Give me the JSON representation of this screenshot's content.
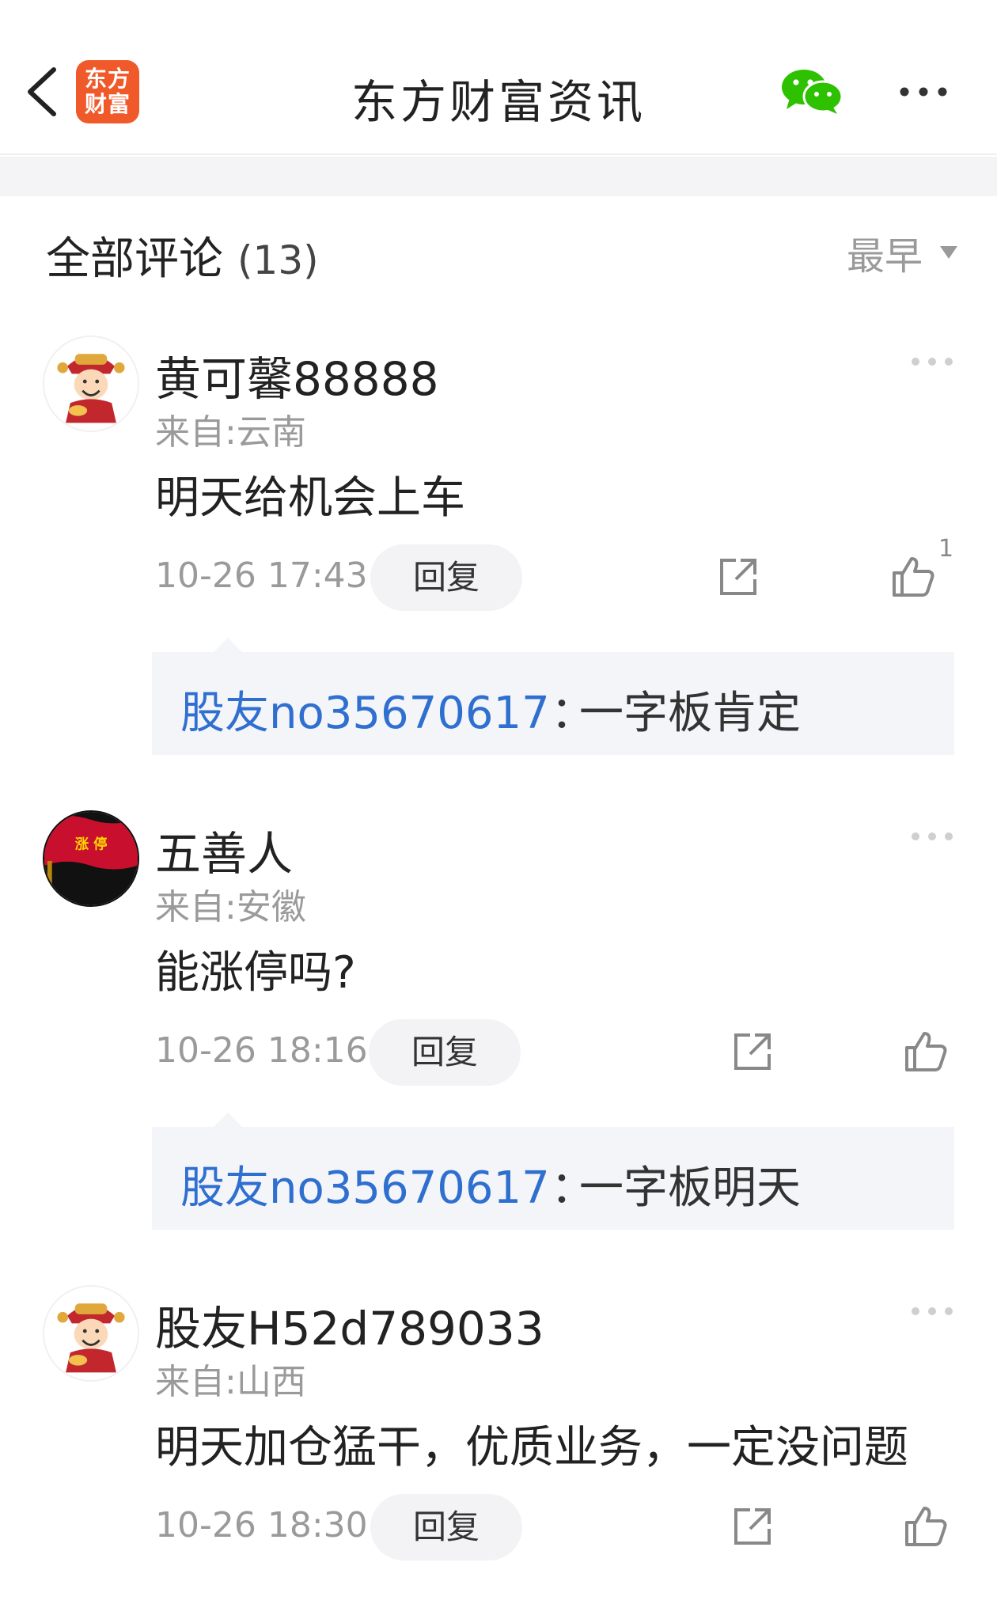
{
  "header": {
    "title": "东方财富资讯",
    "logo_line1": "东方",
    "logo_line2": "财富",
    "back_icon": "chevron-left-icon",
    "share_icon": "wechat-icon",
    "more_icon": "more-horizontal-icon"
  },
  "comments_section": {
    "title": "全部评论",
    "count": "(13)",
    "sort_label": "最早"
  },
  "comments": [
    {
      "username": "黄可馨88888",
      "location": "来自:云南",
      "content": "明天给机会上车",
      "time": "10-26 17:43",
      "reply_label": "回复",
      "like_count": "1",
      "sub_reply": {
        "user": "股友no35670617",
        "sep": "：",
        "text": "一字板肯定"
      }
    },
    {
      "username": "五善人",
      "location": "来自:安徽",
      "content": "能涨停吗?",
      "time": "10-26 18:16",
      "reply_label": "回复",
      "like_count": "",
      "avatar_text": "涨 停",
      "sub_reply": {
        "user": "股友no35670617",
        "sep": "：",
        "text": "一字板明天"
      }
    },
    {
      "username": "股友H52d789033",
      "location": "来自:山西",
      "content": "明天加仓猛干，优质业务，一定没问题",
      "time": "10-26 18:30",
      "reply_label": "回复",
      "like_count": ""
    }
  ],
  "colors": {
    "brand": "#f05a2a",
    "link": "#2f6fd0",
    "muted": "#9a9a9a",
    "wechat": "#2dc100"
  }
}
